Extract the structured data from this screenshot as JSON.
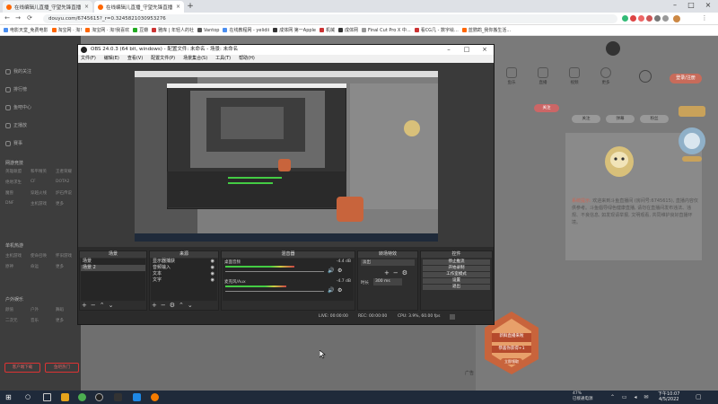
{
  "browser": {
    "tabs": [
      {
        "title": "在线编辑儿直播_守望先锋直播"
      },
      {
        "title": "在线编辑儿直播_守望先锋直播"
      }
    ],
    "url": "douyu.com/6745615?_r=0.3245821030953276",
    "bookmarks": [
      "电影天堂_免费电影",
      "淘宝网 · 淘!",
      "淘宝网 · 淘!我喜欢",
      "豆瓣",
      "雅库 | 年轻人的社",
      "Vantop",
      "在线教程网 - yelidii",
      "成体网 第一Apple",
      "机械",
      "成体网",
      "Final Cut Pro X 中...",
      "看CG几 - 数字绘...",
      "蓝鹦鹉_我你搬生活..."
    ]
  },
  "sidebar": {
    "items": [
      {
        "label": "我的关注"
      },
      {
        "label": "排行榜"
      },
      {
        "label": "鱼吧中心"
      },
      {
        "label": "正播放"
      },
      {
        "label": "赛事"
      }
    ],
    "section1": "网游竞技",
    "section1_items": [
      "英雄联盟",
      "和平精英",
      "王者荣耀",
      "绝地求生",
      "CF",
      "DOTA2",
      "魔兽",
      "穿越火线",
      "炉石传说",
      "DNF",
      "主机游戏",
      "更多"
    ],
    "section2": "单机热游",
    "section2_items": [
      "主机游戏",
      "使命召唤",
      "怀旧游戏",
      "原神",
      "命运",
      "更多"
    ],
    "section3": "户外娱乐",
    "section3_items": [
      "颜值",
      "户外",
      "舞蹈",
      "二次元",
      "音乐",
      "更多"
    ],
    "btn_left": "客户端下载",
    "btn_right": "鱼吧热门"
  },
  "site_header": {
    "icons": [
      "鱼乐",
      "直播",
      "视频",
      "更多"
    ],
    "login": "登录/注册",
    "pills": [
      "关注",
      "弹幕",
      "粉丝"
    ],
    "follow": "关注"
  },
  "notice": {
    "prefix": "系统提示:",
    "text": "欢迎来到斗鱼直播间 (房间号:6745615), 直播内容仅供参考。斗鱼倡导绿色健康直播, 请勿在直播间发布违法、违规、不良信息, 如发现请举报, 文明观看, 共同维护良好直播环境。"
  },
  "gift": {
    "title": "新鲜直播来啦",
    "subtitle": "恭喜你获得+1",
    "button": "立即领取"
  },
  "ad_label": "广告",
  "obs": {
    "title": "OBS 24.0.3 (64 bit, windows) - 配置文件: 未命名 - 场景: 未命名",
    "menu": [
      "文件(F)",
      "编辑(E)",
      "查看(V)",
      "配置文件(P)",
      "场景集合(S)",
      "工具(T)",
      "帮助(H)"
    ],
    "scenes_header": "场景",
    "scenes": [
      "场景",
      "场景 2"
    ],
    "sources_header": "来源",
    "sources": [
      "显示器捕获",
      "音频输入",
      "文本",
      "文字"
    ],
    "mixer_header": "混音器",
    "mixer": [
      {
        "name": "桌面音频",
        "db": "-4.4 dB",
        "level": 0.7
      },
      {
        "name": "麦克风/Aux",
        "db": "-4.7 dB",
        "level": 0.62
      }
    ],
    "transitions_header": "转场特效",
    "transition_type": "淡出",
    "duration_label": "时长",
    "duration": "300 ms",
    "controls_header": "控件",
    "controls": [
      "停止推流",
      "开始录制",
      "工作室模式",
      "设置",
      "退出"
    ],
    "status": {
      "drop": "LIVE: 00:00:00",
      "rec": "REC: 00:00:00",
      "cpu": "CPU: 3.9%, 60.00 fps"
    }
  },
  "taskbar": {
    "battery": "47%",
    "battery_label": "已接通电源",
    "time": "下午10:07",
    "date": "4/5/2022"
  }
}
